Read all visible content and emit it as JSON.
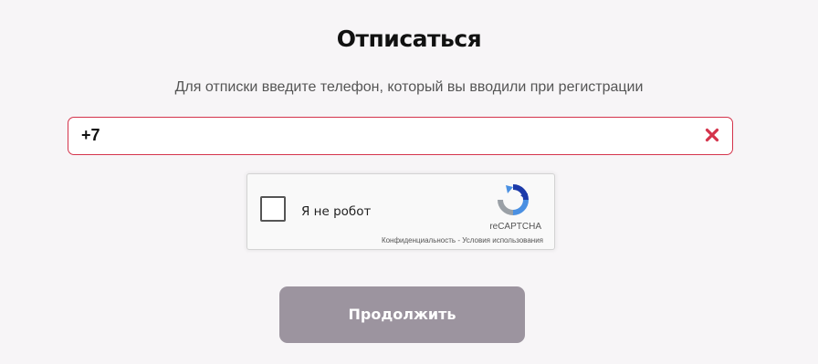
{
  "page": {
    "title": "Отписаться",
    "subtitle": "Для отписки введите телефон, который вы вводили при регистрации"
  },
  "phone_field": {
    "value": "+7",
    "clear_icon": "close-x-icon",
    "border_color": "#d4334b"
  },
  "captcha": {
    "checkbox_label": "Я не робот",
    "brand": "reCAPTCHA",
    "privacy_link": "Конфиденциальность",
    "separator": " - ",
    "terms_link": "Условия использования",
    "logo_icon": "recaptcha-logo-icon"
  },
  "continue_button": {
    "label": "Продолжить",
    "color": "#9c949f"
  },
  "colors": {
    "background": "#f7f5f7",
    "accent_red": "#d4334b"
  }
}
